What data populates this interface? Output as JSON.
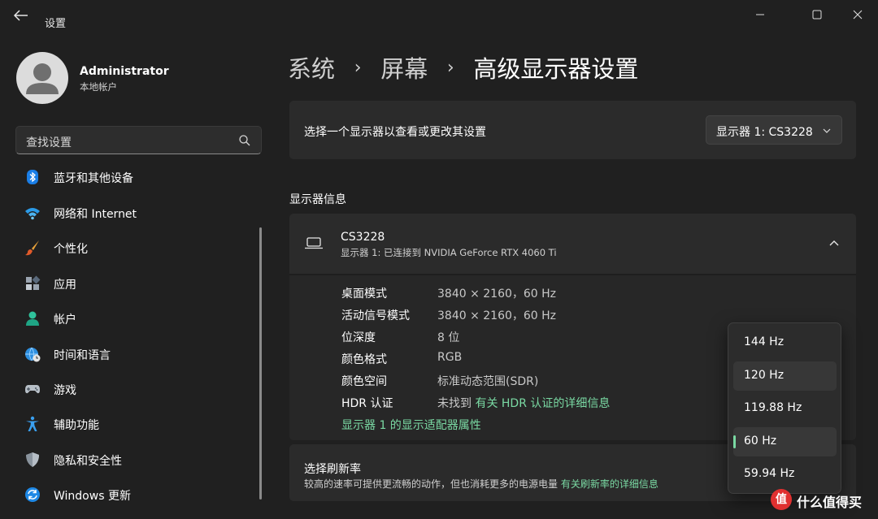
{
  "window": {
    "title": "设置",
    "icons": [
      "back-icon",
      "minimize-icon",
      "maximize-icon",
      "close-icon"
    ]
  },
  "profile": {
    "name": "Administrator",
    "account_type": "本地帐户"
  },
  "search": {
    "placeholder": "查找设置"
  },
  "sidebar": {
    "items": [
      {
        "label": "蓝牙和其他设备",
        "icon": "bluetooth-icon"
      },
      {
        "label": "网络和 Internet",
        "icon": "wifi-icon"
      },
      {
        "label": "个性化",
        "icon": "brush-icon"
      },
      {
        "label": "应用",
        "icon": "apps-icon"
      },
      {
        "label": "帐户",
        "icon": "account-icon"
      },
      {
        "label": "时间和语言",
        "icon": "globe-clock-icon"
      },
      {
        "label": "游戏",
        "icon": "gamepad-icon"
      },
      {
        "label": "辅助功能",
        "icon": "accessibility-icon"
      },
      {
        "label": "隐私和安全性",
        "icon": "shield-icon"
      },
      {
        "label": "Windows 更新",
        "icon": "update-icon"
      }
    ]
  },
  "breadcrumb": {
    "items": [
      "系统",
      "屏幕",
      "高级显示器设置"
    ],
    "separator": "›"
  },
  "select_display": {
    "label": "选择一个显示器以查看或更改其设置",
    "selected": "显示器 1: CS3228"
  },
  "display_info": {
    "heading": "显示器信息",
    "monitor_name": "CS3228",
    "monitor_subtitle": "显示器 1: 已连接到 NVIDIA GeForce RTX 4060 Ti",
    "rows": [
      {
        "label": "桌面模式",
        "value": "3840 × 2160，60 Hz"
      },
      {
        "label": "活动信号模式",
        "value": "3840 × 2160，60 Hz"
      },
      {
        "label": "位深度",
        "value": "8 位"
      },
      {
        "label": "颜色格式",
        "value": "RGB"
      },
      {
        "label": "颜色空间",
        "value": "标准动态范围(SDR)"
      },
      {
        "label": "HDR 认证",
        "value": "未找到",
        "link": "有关 HDR 认证的详细信息"
      }
    ],
    "adapter_link": "显示器 1 的显示适配器属性"
  },
  "refresh_rate": {
    "title": "选择刷新率",
    "description": "较高的速率可提供更流畅的动作，但也消耗更多的电源电量",
    "link": "有关刷新率的详细信息",
    "options": [
      "144 Hz",
      "120 Hz",
      "119.88 Hz",
      "60 Hz",
      "59.94 Hz"
    ],
    "selected": "60 Hz",
    "hovered": "120 Hz"
  },
  "watermark": {
    "badge": "值",
    "text": "什么值得买"
  },
  "colors": {
    "background": "#202020",
    "card": "#2b2b2b",
    "accent": "#7ad9a3",
    "text": "#ffffff"
  }
}
